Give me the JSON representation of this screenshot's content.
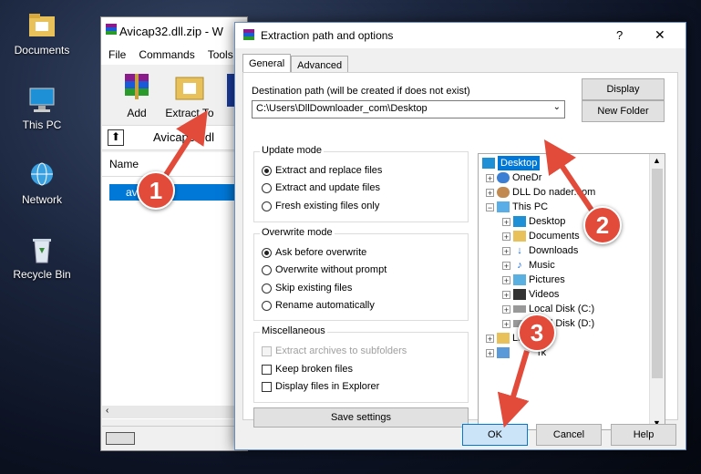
{
  "desktop": {
    "icons": [
      {
        "label": "Documents"
      },
      {
        "label": "This PC"
      },
      {
        "label": "Network"
      },
      {
        "label": "Recycle Bin"
      }
    ]
  },
  "bg_window": {
    "title": "Avicap32.dll.zip - W",
    "menu": [
      "File",
      "Commands",
      "Tools"
    ],
    "toolbar": [
      "Add",
      "Extract To"
    ],
    "path_text": "Avicap32.dl",
    "list_header": "Name",
    "file_name": "avicap32.dll",
    "file_visible": "av      32.dll"
  },
  "dialog": {
    "title": "Extraction path and options",
    "help": "?",
    "close": "✕",
    "tabs": [
      "General",
      "Advanced"
    ],
    "dest_label": "Destination path (will be created if does not exist)",
    "dest_value": "C:\\Users\\DllDownloader_com\\Desktop",
    "display_btn": "Display",
    "new_folder_btn": "New Folder",
    "update_mode": {
      "title": "Update mode",
      "options": [
        "Extract and replace files",
        "Extract and update files",
        "Fresh existing files only"
      ],
      "selected": 0
    },
    "overwrite_mode": {
      "title": "Overwrite mode",
      "options": [
        "Ask before overwrite",
        "Overwrite without prompt",
        "Skip existing files",
        "Rename automatically"
      ],
      "selected": 0
    },
    "misc": {
      "title": "Miscellaneous",
      "options": [
        "Extract archives to subfolders",
        "Keep broken files",
        "Display files in Explorer"
      ]
    },
    "save_settings": "Save settings",
    "tree": {
      "items": [
        "Desktop",
        "OneDr",
        "DLL Do      nader.com",
        "This PC",
        "Desktop",
        "Documents",
        "Downloads",
        "Music",
        "Pictures",
        "Videos",
        "Local Disk (C:)",
        "Local Disk (D:)",
        "Libraries",
        "rk"
      ]
    },
    "ok": "OK",
    "cancel": "Cancel",
    "help_btn": "Help"
  },
  "annotations": [
    "1",
    "2",
    "3"
  ],
  "colors": {
    "annotation": "#e24a3a",
    "selection": "#0078d7"
  }
}
